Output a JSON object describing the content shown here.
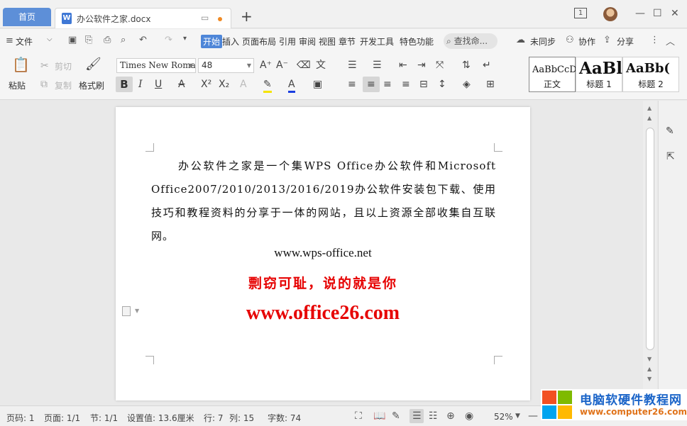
{
  "titlebar": {
    "home_tab": "首页",
    "doc_icon": "W",
    "doc_title": "办公软件之家.docx",
    "new_tab": "+",
    "page_indicator": "1"
  },
  "menu": {
    "items": [
      "文件",
      "开始",
      "插入",
      "页面布局",
      "引用",
      "审阅",
      "视图",
      "章节",
      "开发工具",
      "特色功能"
    ],
    "active": "开始",
    "search_placeholder": "查找命...",
    "sync": "未同步",
    "collab": "协作",
    "share": "分享"
  },
  "ribbon": {
    "paste": "粘贴",
    "cut": "剪切",
    "copy": "复制",
    "format_painter": "格式刷",
    "font_name": "Times New Roma",
    "font_size": "48",
    "styles": [
      {
        "sample": "AaBbCcD",
        "label": "正文"
      },
      {
        "sample": "AaBl",
        "label": "标题 1"
      },
      {
        "sample": "AaBb(",
        "label": "标题 2"
      }
    ]
  },
  "document": {
    "paragraph": "办公软件之家是一个集WPS Office办公软件和Microsoft Office2007/2010/2013/2016/2019办公软件安装包下载、使用技巧和教程资料的分享于一体的网站，且以上资源全部收集自互联网。",
    "url_line": "www.wps-office.net",
    "slogan": "剽窃可耻，说的就是你",
    "big_url": "www.office26.com",
    "accent_color": "#e60000"
  },
  "status": {
    "page_no": "页码: 1",
    "pages": "页面: 1/1",
    "section": "节: 1/1",
    "setting": "设置值: 13.6厘米",
    "row": "行: 7",
    "col": "列: 15",
    "words": "字数: 74",
    "zoom": "52%"
  },
  "watermark": {
    "line1": "电脑软硬件教程网",
    "line2": "www.computer26.com"
  }
}
